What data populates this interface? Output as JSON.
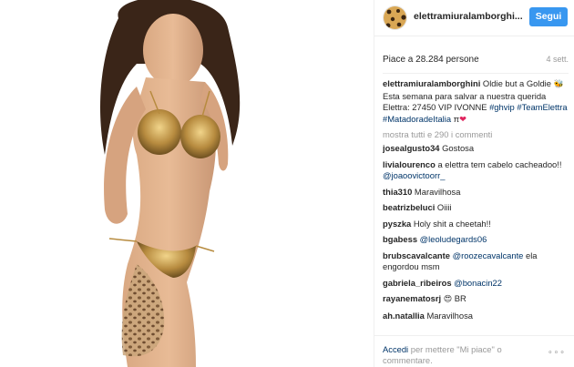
{
  "post": {
    "username": "elettramiuralamborghi...",
    "follow_label": "Segui",
    "likes": "Piace a 28.284 persone",
    "age": "4 sett.",
    "caption_user": "elettramiuralamborghini",
    "caption_text_1": " Oldie but a Goldie ",
    "caption_emoji_1": "🐝",
    "caption_text_2": " Esta semana para salvar a nuestra querida Elettra: 27450 VIP IVONNE ",
    "caption_tags": [
      "#ghvip",
      "#TeamElettra",
      "#MatadoradeItalia"
    ],
    "caption_end": " π",
    "caption_heart": "❤",
    "show_all_comments": "mostra tutti e 290 i commenti",
    "comments": [
      {
        "user": "josealgusto34",
        "text": "Gostosa",
        "mention": ""
      },
      {
        "user": "livialourenco",
        "text": "a elettra tem cabelo cacheadoo!! ",
        "mention": "@joaoovictoorr_"
      },
      {
        "user": "thia310",
        "text": "Maravilhosa",
        "mention": ""
      },
      {
        "user": "beatrizbeluci",
        "text": "Oiiii",
        "mention": ""
      },
      {
        "user": "pyszka",
        "text": "Holy shit a cheetah!!",
        "mention": ""
      },
      {
        "user": "bgabess",
        "text": "",
        "mention": "@leoludegards06"
      },
      {
        "user": "brubscavalcante",
        "text": " ela engordou msm",
        "mention": "@roozecavalcante"
      },
      {
        "user": "gabriela_ribeiros",
        "text": "",
        "mention": "@bonacin22"
      },
      {
        "user": "rayanematosrj",
        "text": " BR",
        "mention": "",
        "emoji": "😍"
      },
      {
        "user": "ah.natallia",
        "text": "Maravilhosa",
        "mention": ""
      }
    ],
    "footer_login": "Accedi",
    "footer_text": " per mettere \"Mi piace\" o commentare.",
    "more_options": "∘∘∘"
  },
  "colors": {
    "accent": "#3897f0",
    "link": "#003569",
    "muted": "#999999"
  }
}
